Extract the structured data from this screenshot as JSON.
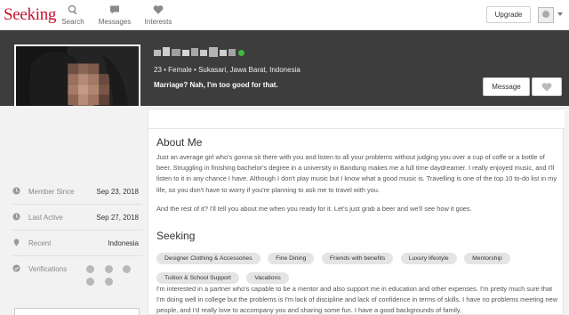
{
  "brand": {
    "logo": "Seeking",
    "accent": "#c8102e"
  },
  "nav": {
    "items": [
      {
        "label": "Search",
        "icon": "search-icon"
      },
      {
        "label": "Messages",
        "icon": "chat-icon"
      },
      {
        "label": "Interests",
        "icon": "heart-icon"
      }
    ],
    "upgrade_label": "Upgrade"
  },
  "profile": {
    "meta": "23 • Female • Sukasari, Jawa Barat, Indonesia",
    "tagline": "Marriage? Nah, I'm too good for that.",
    "online_color": "#3fb83f",
    "message_label": "Message"
  },
  "stats": [
    {
      "label": "Member Since",
      "value": "Sep 23, 2018",
      "icon": "clock-icon"
    },
    {
      "label": "Last Active",
      "value": "Sep 27, 2018",
      "icon": "clock-icon"
    },
    {
      "label": "Recent",
      "value": "Indonesia",
      "icon": "location-icon"
    },
    {
      "label": "Verifications",
      "value": "",
      "icon": "check-circle-icon"
    }
  ],
  "about": {
    "heading": "About Me",
    "p1": "Just an average girl who's gonna sit there with you and listen to all your problems without judging you over a cup of coffe or a bottle of beer. Struggling in finishing bachelor's degree in a university in Bandung makes me a full time daydreamer. I really enjoyed music, and I'll listen to it in any chance I have. Although I don't play music but I know what a good music is. Travelling is one of the top 10 to-do list in my life, so you don't have to worry if you're planning to ask me to travel with you.",
    "p2": "And the rest of it? I'll tell you about me when you ready for it. Let's just grab a beer and we'll see how it goes."
  },
  "seeking": {
    "heading": "Seeking",
    "tags": [
      "Designer Clothing & Accessories",
      "Fine Dining",
      "Friends with benefits",
      "Luxury lifestyle",
      "Mentorship",
      "Tuition & School Support",
      "Vacations"
    ],
    "text": "I'm interested in a partner who's capable to be a mentor and also support me in education and other expenses. I'm pretty much sure that I'm doing well in college but the problems is I'm lack of discipline and lack of confidence in terms of skills. I have no problems meeting new people, and I'd really love to accompany you and sharing some fun. I have a good backgrounds of family,"
  }
}
